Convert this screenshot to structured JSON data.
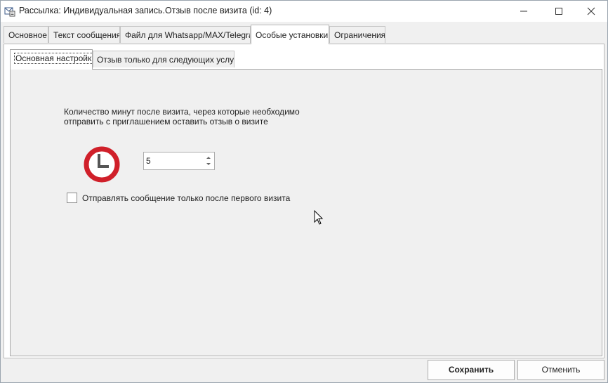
{
  "window": {
    "title": "Рассылка: Индивидуальная запись.Отзыв после визита (id: 4)"
  },
  "tabs": [
    {
      "label": "Основное"
    },
    {
      "label": "Текст сообщения"
    },
    {
      "label": "Файл для Whatsapp/MAX/Telegram"
    },
    {
      "label": "Особые установки",
      "active": true
    },
    {
      "label": "Ограничения"
    }
  ],
  "subtabs": [
    {
      "label": "Основная настройка",
      "active": true
    },
    {
      "label": "Отзыв только для следующих услуг"
    }
  ],
  "settings": {
    "description_line1": "Количество минут после визита, через которые необходимо",
    "description_line2": "отправить с приглашением оставить отзыв о визите",
    "minutes_value": "5",
    "first_visit_only_label": "Отправлять сообщение только после первого визита",
    "first_visit_only_checked": false
  },
  "buttons": {
    "save": "Сохранить",
    "cancel": "Отменить"
  },
  "colors": {
    "clock_ring": "#d0202a",
    "clock_hands": "#555555"
  },
  "icons": [
    "app-mail-icon",
    "minimize-icon",
    "maximize-icon",
    "close-icon",
    "clock-icon",
    "spin-up-icon",
    "spin-down-icon",
    "mouse-cursor-icon"
  ]
}
